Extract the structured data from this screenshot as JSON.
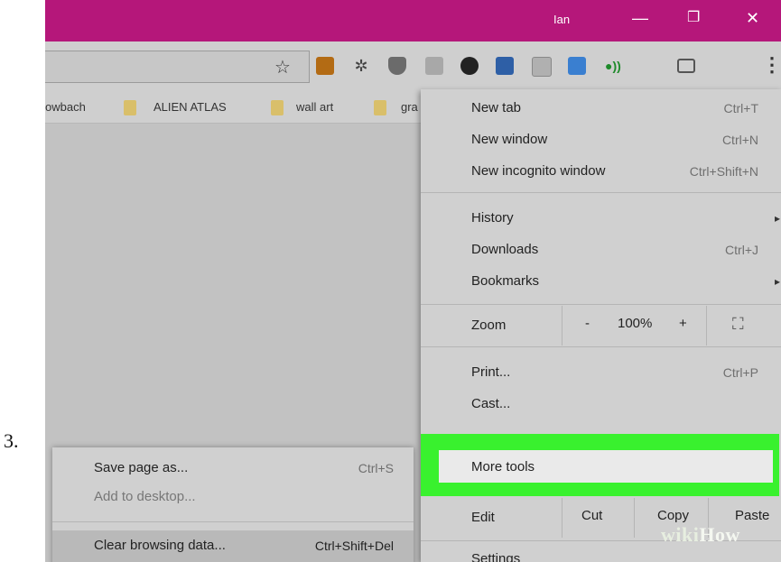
{
  "step_number": "3.",
  "window": {
    "user": "Ian",
    "minimize_glyph": "—",
    "restore_glyph": "❐",
    "close_glyph": "✕",
    "titlebar_color": "#b5177a"
  },
  "toolbar": {
    "star_glyph": "☆",
    "menu_glyph": "⋮",
    "extension_icons": [
      "hexagon-ext-icon",
      "bug-ext-icon",
      "pocket-ext-icon",
      "pdf-ext-icon",
      "color-ext-icon",
      "bookmark-ext-icon",
      "image-ext-icon",
      "download-ext-icon",
      "audio-ext-icon",
      "cast-icon"
    ]
  },
  "bookmarks": {
    "items": [
      "owbach",
      "ALIEN ATLAS",
      "wall art",
      "gra"
    ]
  },
  "menu": {
    "new_tab": {
      "label": "New tab",
      "shortcut": "Ctrl+T"
    },
    "new_window": {
      "label": "New window",
      "shortcut": "Ctrl+N"
    },
    "new_incognito": {
      "label": "New incognito window",
      "shortcut": "Ctrl+Shift+N"
    },
    "history": {
      "label": "History",
      "arrow": "▸"
    },
    "downloads": {
      "label": "Downloads",
      "shortcut": "Ctrl+J"
    },
    "bookmarks": {
      "label": "Bookmarks",
      "arrow": "▸"
    },
    "zoom": {
      "label": "Zoom",
      "minus": "-",
      "level": "100%",
      "plus": "+",
      "fullscreen_glyph": "⛶"
    },
    "print": {
      "label": "Print...",
      "shortcut": "Ctrl+P"
    },
    "cast": {
      "label": "Cast..."
    },
    "more_tools": {
      "label": "More tools"
    },
    "edit": {
      "label": "Edit",
      "cut": "Cut",
      "copy": "Copy",
      "paste": "Paste"
    },
    "settings": {
      "label": "Settings"
    }
  },
  "submenu": {
    "save_page": {
      "label": "Save page as...",
      "shortcut": "Ctrl+S"
    },
    "add_desktop": {
      "label": "Add to desktop..."
    },
    "clear_browsing": {
      "label": "Clear browsing data...",
      "shortcut": "Ctrl+Shift+Del"
    }
  },
  "watermark": {
    "wiki": "wiki",
    "how": "How"
  },
  "colors": {
    "highlight": "#39f12e",
    "titlebar": "#b5177a"
  }
}
